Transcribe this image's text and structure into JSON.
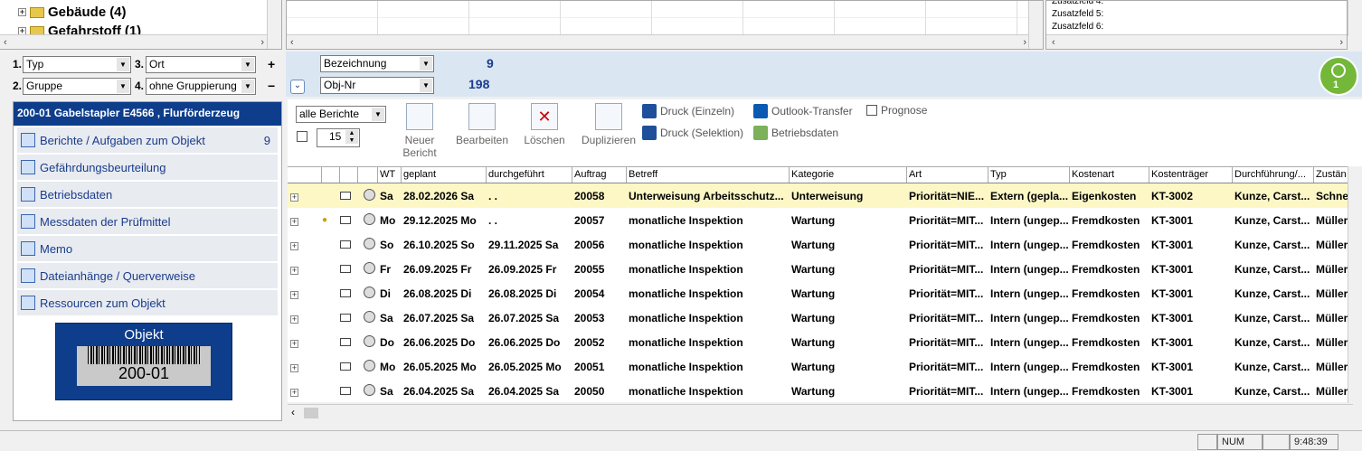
{
  "tree": {
    "nodes": [
      {
        "label": "Gebäude",
        "count": "(4)"
      },
      {
        "label": "Gefahrstoff",
        "count": "(1)"
      }
    ],
    "expander": "+"
  },
  "fields_panel": {
    "items": [
      "Zusatzfeld 4:",
      "Zusatzfeld 5:",
      "Zusatzfeld 6:"
    ]
  },
  "filters": {
    "group1_num": "1.",
    "group1_value": "Typ",
    "group2_num": "2.",
    "group2_value": "Gruppe",
    "group3_num": "3.",
    "group3_value": "Ort",
    "group4_num": "4.",
    "group4_value": "ohne Gruppierung",
    "plus": "+",
    "minus": "−",
    "sort1": "Bezeichnung",
    "sort1_count": "9",
    "sort2": "Obj-Nr",
    "sort2_count": "198",
    "collapse": "⌄"
  },
  "avatar": {
    "badge": "1"
  },
  "sidebar": {
    "header": "200-01 Gabelstapler E4566 , Flurförderzeug",
    "items": [
      {
        "label": "Berichte / Aufgaben zum Objekt",
        "count": "9"
      },
      {
        "label": "Gefährdungsbeurteilung",
        "count": ""
      },
      {
        "label": "Betriebsdaten",
        "count": ""
      },
      {
        "label": "Messdaten der Prüfmittel",
        "count": ""
      },
      {
        "label": "Memo",
        "count": ""
      },
      {
        "label": "Dateianhänge / Querverweise",
        "count": ""
      },
      {
        "label": "Ressourcen zum Objekt",
        "count": ""
      }
    ],
    "card_title": "Objekt",
    "card_number": "200-01"
  },
  "toolbar": {
    "report_filter": "alle Berichte",
    "count_value": "15",
    "new_report": "Neuer Bericht",
    "edit": "Bearbeiten",
    "delete": "Löschen",
    "duplicate": "Duplizieren",
    "print_single": "Druck (Einzeln)",
    "print_selection": "Druck (Selektion)",
    "outlook": "Outlook-Transfer",
    "operating_data": "Betriebsdaten",
    "forecast": "Prognose"
  },
  "table": {
    "columns": [
      "WT",
      "geplant",
      "durchgeführt",
      "Auftrag",
      "Betreff",
      "Kategorie",
      "Art",
      "Typ",
      "Kostenart",
      "Kostenträger",
      "Durchführung/...",
      "Zustän"
    ],
    "rows": [
      [
        "Sa",
        "28.02.2026 Sa",
        ". .",
        "20058",
        "Unterweisung Arbeitsschutz...",
        "Unterweisung",
        "Priorität=NIE...",
        "Extern (gepla...",
        "Eigenkosten",
        "KT-3002",
        "Kunze, Carst...",
        "Schnei"
      ],
      [
        "Mo",
        "29.12.2025 Mo",
        ". .",
        "20057",
        "monatliche Inspektion",
        "Wartung",
        "Priorität=MIT...",
        "Intern (ungep...",
        "Fremdkosten",
        "KT-3001",
        "Kunze, Carst...",
        "Müller,"
      ],
      [
        "So",
        "26.10.2025 So",
        "29.11.2025 Sa",
        "20056",
        "monatliche Inspektion",
        "Wartung",
        "Priorität=MIT...",
        "Intern (ungep...",
        "Fremdkosten",
        "KT-3001",
        "Kunze, Carst...",
        "Müller,"
      ],
      [
        "Fr",
        "26.09.2025 Fr",
        "26.09.2025 Fr",
        "20055",
        "monatliche Inspektion",
        "Wartung",
        "Priorität=MIT...",
        "Intern (ungep...",
        "Fremdkosten",
        "KT-3001",
        "Kunze, Carst...",
        "Müller,"
      ],
      [
        "Di",
        "26.08.2025 Di",
        "26.08.2025 Di",
        "20054",
        "monatliche Inspektion",
        "Wartung",
        "Priorität=MIT...",
        "Intern (ungep...",
        "Fremdkosten",
        "KT-3001",
        "Kunze, Carst...",
        "Müller,"
      ],
      [
        "Sa",
        "26.07.2025 Sa",
        "26.07.2025 Sa",
        "20053",
        "monatliche Inspektion",
        "Wartung",
        "Priorität=MIT...",
        "Intern (ungep...",
        "Fremdkosten",
        "KT-3001",
        "Kunze, Carst...",
        "Müller,"
      ],
      [
        "Do",
        "26.06.2025 Do",
        "26.06.2025 Do",
        "20052",
        "monatliche Inspektion",
        "Wartung",
        "Priorität=MIT...",
        "Intern (ungep...",
        "Fremdkosten",
        "KT-3001",
        "Kunze, Carst...",
        "Müller,"
      ],
      [
        "Mo",
        "26.05.2025 Mo",
        "26.05.2025 Mo",
        "20051",
        "monatliche Inspektion",
        "Wartung",
        "Priorität=MIT...",
        "Intern (ungep...",
        "Fremdkosten",
        "KT-3001",
        "Kunze, Carst...",
        "Müller,"
      ],
      [
        "Sa",
        "26.04.2025 Sa",
        "26.04.2025 Sa",
        "20050",
        "monatliche Inspektion",
        "Wartung",
        "Priorität=MIT...",
        "Intern (ungep...",
        "Fremdkosten",
        "KT-3001",
        "Kunze, Carst...",
        "Müller,"
      ]
    ]
  },
  "statusbar": {
    "num": "NUM",
    "time": "9:48:39"
  },
  "colors": {
    "accent": "#0e3d8c",
    "highlight_row": "#fdf7c6",
    "filter_bg": "#dbe6f3"
  }
}
